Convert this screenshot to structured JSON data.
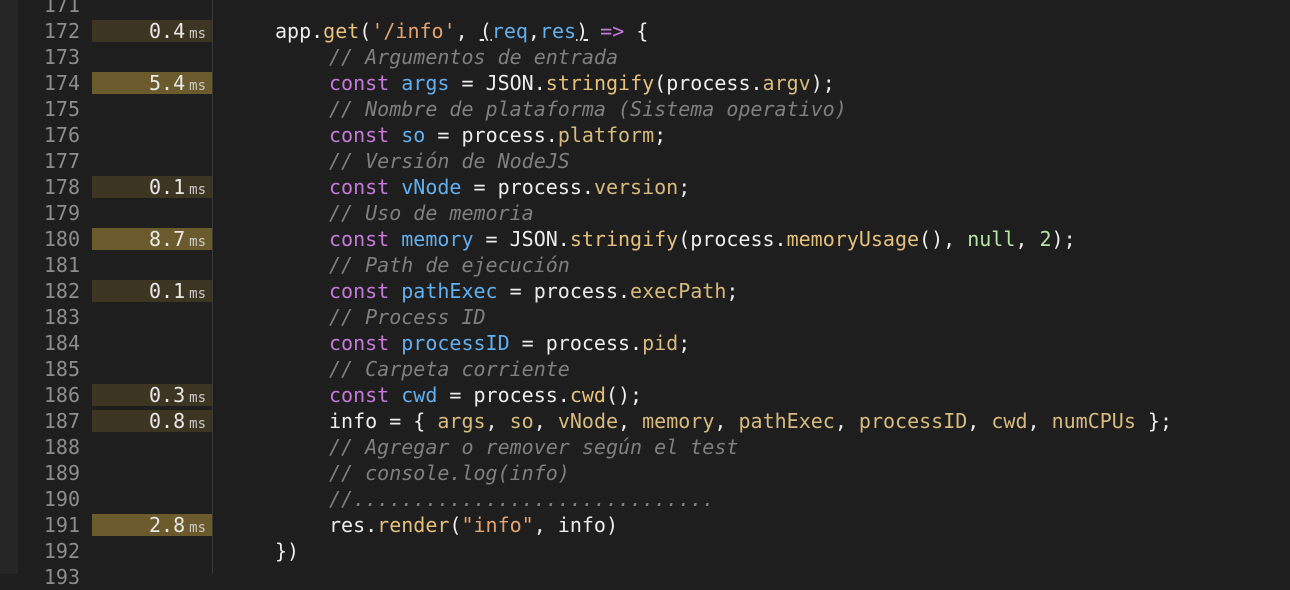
{
  "colors": {
    "background": "#1e1e1e",
    "line_number": "#8d8d8d",
    "timing_light": "#3c3522",
    "timing_heavy": "#6b5a2c",
    "plain": "#ececec",
    "keyword": "#c678dd",
    "variable": "#61afef",
    "function": "#e5c07b",
    "property": "#d7ba7d",
    "string": "#e3a36f",
    "comment": "#7f7f7f",
    "literal": "#b5e6a8"
  },
  "timing_unit": "ms",
  "lines": [
    {
      "number": "171",
      "timing": "",
      "heavy": false,
      "indent": 0,
      "tokens": []
    },
    {
      "number": "172",
      "timing": "0.4",
      "heavy": false,
      "indent": 0,
      "tokens": [
        {
          "t": "app.",
          "c": "plain"
        },
        {
          "t": "get",
          "c": "function"
        },
        {
          "t": "(",
          "c": "plain"
        },
        {
          "t": "'/info'",
          "c": "string"
        },
        {
          "t": ", ",
          "c": "plain"
        },
        {
          "t": "(",
          "c": "plain",
          "u": true
        },
        {
          "t": "req",
          "c": "variable"
        },
        {
          "t": ",",
          "c": "plain"
        },
        {
          "t": "res",
          "c": "variable"
        },
        {
          "t": ")",
          "c": "plain",
          "u": true
        },
        {
          "t": " ",
          "c": "plain"
        },
        {
          "t": "=>",
          "c": "keyword"
        },
        {
          "t": " {",
          "c": "plain"
        }
      ]
    },
    {
      "number": "173",
      "timing": "",
      "heavy": false,
      "indent": 1,
      "tokens": [
        {
          "t": "// Argumentos de entrada",
          "c": "comment"
        }
      ]
    },
    {
      "number": "174",
      "timing": "5.4",
      "heavy": true,
      "indent": 1,
      "tokens": [
        {
          "t": "const",
          "c": "keyword"
        },
        {
          "t": " ",
          "c": "plain"
        },
        {
          "t": "args",
          "c": "variable"
        },
        {
          "t": " = ",
          "c": "plain"
        },
        {
          "t": "JSON",
          "c": "plain"
        },
        {
          "t": ".",
          "c": "plain"
        },
        {
          "t": "stringify",
          "c": "function"
        },
        {
          "t": "(process.",
          "c": "plain"
        },
        {
          "t": "argv",
          "c": "property"
        },
        {
          "t": ");",
          "c": "plain"
        }
      ]
    },
    {
      "number": "175",
      "timing": "",
      "heavy": false,
      "indent": 1,
      "tokens": [
        {
          "t": "// Nombre de plataforma (Sistema operativo)",
          "c": "comment"
        }
      ]
    },
    {
      "number": "176",
      "timing": "",
      "heavy": false,
      "indent": 1,
      "tokens": [
        {
          "t": "const",
          "c": "keyword"
        },
        {
          "t": " ",
          "c": "plain"
        },
        {
          "t": "so",
          "c": "variable"
        },
        {
          "t": " = process.",
          "c": "plain"
        },
        {
          "t": "platform",
          "c": "property"
        },
        {
          "t": ";",
          "c": "plain"
        }
      ]
    },
    {
      "number": "177",
      "timing": "",
      "heavy": false,
      "indent": 1,
      "tokens": [
        {
          "t": "// Versión de NodeJS",
          "c": "comment"
        }
      ]
    },
    {
      "number": "178",
      "timing": "0.1",
      "heavy": false,
      "indent": 1,
      "tokens": [
        {
          "t": "const",
          "c": "keyword"
        },
        {
          "t": " ",
          "c": "plain"
        },
        {
          "t": "vNode",
          "c": "variable"
        },
        {
          "t": " = process.",
          "c": "plain"
        },
        {
          "t": "version",
          "c": "property"
        },
        {
          "t": ";",
          "c": "plain"
        }
      ]
    },
    {
      "number": "179",
      "timing": "",
      "heavy": false,
      "indent": 1,
      "tokens": [
        {
          "t": "// Uso de memoria",
          "c": "comment"
        }
      ]
    },
    {
      "number": "180",
      "timing": "8.7",
      "heavy": true,
      "indent": 1,
      "tokens": [
        {
          "t": "const",
          "c": "keyword"
        },
        {
          "t": " ",
          "c": "plain"
        },
        {
          "t": "memory",
          "c": "variable"
        },
        {
          "t": " = JSON.",
          "c": "plain"
        },
        {
          "t": "stringify",
          "c": "function"
        },
        {
          "t": "(process.",
          "c": "plain"
        },
        {
          "t": "memoryUsage",
          "c": "function"
        },
        {
          "t": "(), ",
          "c": "plain"
        },
        {
          "t": "null",
          "c": "literal"
        },
        {
          "t": ", ",
          "c": "plain"
        },
        {
          "t": "2",
          "c": "literal"
        },
        {
          "t": ");",
          "c": "plain"
        }
      ]
    },
    {
      "number": "181",
      "timing": "",
      "heavy": false,
      "indent": 1,
      "tokens": [
        {
          "t": "// Path de ejecución",
          "c": "comment"
        }
      ]
    },
    {
      "number": "182",
      "timing": "0.1",
      "heavy": false,
      "indent": 1,
      "tokens": [
        {
          "t": "const",
          "c": "keyword"
        },
        {
          "t": " ",
          "c": "plain"
        },
        {
          "t": "pathExec",
          "c": "variable"
        },
        {
          "t": " = process.",
          "c": "plain"
        },
        {
          "t": "execPath",
          "c": "property"
        },
        {
          "t": ";",
          "c": "plain"
        }
      ]
    },
    {
      "number": "183",
      "timing": "",
      "heavy": false,
      "indent": 1,
      "tokens": [
        {
          "t": "// Process ID",
          "c": "comment"
        }
      ]
    },
    {
      "number": "184",
      "timing": "",
      "heavy": false,
      "indent": 1,
      "tokens": [
        {
          "t": "const",
          "c": "keyword"
        },
        {
          "t": " ",
          "c": "plain"
        },
        {
          "t": "processID",
          "c": "variable"
        },
        {
          "t": " = process.",
          "c": "plain"
        },
        {
          "t": "pid",
          "c": "property"
        },
        {
          "t": ";",
          "c": "plain"
        }
      ]
    },
    {
      "number": "185",
      "timing": "",
      "heavy": false,
      "indent": 1,
      "tokens": [
        {
          "t": "// Carpeta corriente",
          "c": "comment"
        }
      ]
    },
    {
      "number": "186",
      "timing": "0.3",
      "heavy": false,
      "indent": 1,
      "tokens": [
        {
          "t": "const",
          "c": "keyword"
        },
        {
          "t": " ",
          "c": "plain"
        },
        {
          "t": "cwd",
          "c": "variable"
        },
        {
          "t": " = process.",
          "c": "plain"
        },
        {
          "t": "cwd",
          "c": "function"
        },
        {
          "t": "();",
          "c": "plain"
        }
      ]
    },
    {
      "number": "187",
      "timing": "0.8",
      "heavy": false,
      "indent": 1,
      "tokens": [
        {
          "t": "info = { ",
          "c": "plain"
        },
        {
          "t": "args",
          "c": "property"
        },
        {
          "t": ", ",
          "c": "plain"
        },
        {
          "t": "so",
          "c": "property"
        },
        {
          "t": ", ",
          "c": "plain"
        },
        {
          "t": "vNode",
          "c": "property"
        },
        {
          "t": ", ",
          "c": "plain"
        },
        {
          "t": "memory",
          "c": "property"
        },
        {
          "t": ", ",
          "c": "plain"
        },
        {
          "t": "pathExec",
          "c": "property"
        },
        {
          "t": ", ",
          "c": "plain"
        },
        {
          "t": "processID",
          "c": "property"
        },
        {
          "t": ", ",
          "c": "plain"
        },
        {
          "t": "cwd",
          "c": "property"
        },
        {
          "t": ", ",
          "c": "plain"
        },
        {
          "t": "numCPUs",
          "c": "property"
        },
        {
          "t": " };",
          "c": "plain"
        }
      ]
    },
    {
      "number": "188",
      "timing": "",
      "heavy": false,
      "indent": 1,
      "tokens": [
        {
          "t": "// Agregar o remover según el test",
          "c": "comment"
        }
      ]
    },
    {
      "number": "189",
      "timing": "",
      "heavy": false,
      "indent": 1,
      "tokens": [
        {
          "t": "// console.log(info)",
          "c": "comment"
        }
      ]
    },
    {
      "number": "190",
      "timing": "",
      "heavy": false,
      "indent": 1,
      "tokens": [
        {
          "t": "//..............................",
          "c": "comment"
        }
      ]
    },
    {
      "number": "191",
      "timing": "2.8",
      "heavy": true,
      "indent": 1,
      "tokens": [
        {
          "t": "res.",
          "c": "plain"
        },
        {
          "t": "render",
          "c": "function"
        },
        {
          "t": "(",
          "c": "plain"
        },
        {
          "t": "\"info\"",
          "c": "string"
        },
        {
          "t": ", info)",
          "c": "plain"
        }
      ]
    },
    {
      "number": "192",
      "timing": "",
      "heavy": false,
      "indent": 0,
      "tokens": [
        {
          "t": "})",
          "c": "plain"
        }
      ]
    },
    {
      "number": "193",
      "timing": "",
      "heavy": false,
      "indent": 0,
      "tokens": []
    }
  ]
}
